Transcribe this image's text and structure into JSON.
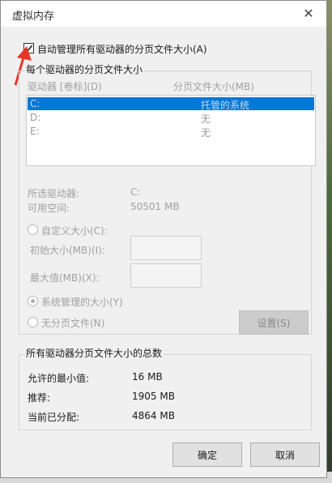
{
  "dialog": {
    "title": "虚拟内存"
  },
  "auto_manage": {
    "label": "自动管理所有驱动器的分页文件大小(A)",
    "checked": true
  },
  "drives_group": {
    "title": "每个驱动器的分页文件大小",
    "col_drive": "驱动器 [卷标](D)",
    "col_size": "分页文件大小(MB)",
    "rows": [
      {
        "drive": "C:",
        "size": "托管的系统",
        "selected": true
      },
      {
        "drive": "D:",
        "size": "无",
        "selected": false
      },
      {
        "drive": "E:",
        "size": "无",
        "selected": false
      }
    ]
  },
  "selected_info": {
    "drive_label": "所选驱动器:",
    "drive_value": "C:",
    "space_label": "可用空间:",
    "space_value": "50501 MB"
  },
  "custom_size": {
    "label": "自定义大小(C):",
    "initial_label": "初始大小(MB)(I):",
    "initial_value": "",
    "max_label": "最大值(MB)(X):",
    "max_value": ""
  },
  "system_managed": {
    "label": "系统管理的大小(Y)",
    "selected": true
  },
  "no_paging": {
    "label": "无分页文件(N)",
    "selected": false
  },
  "set_button": "设置(S)",
  "totals_group": {
    "title": "所有驱动器分页文件大小的总数",
    "min_label": "允许的最小值:",
    "min_value": "16 MB",
    "recommended_label": "推荐:",
    "recommended_value": "1905 MB",
    "allocated_label": "当前已分配:",
    "allocated_value": "4864 MB"
  },
  "buttons": {
    "ok": "确定",
    "cancel": "取消"
  },
  "colors": {
    "accent": "#0078d7",
    "annotation": "#e8352a"
  },
  "icons": {
    "close": "close-icon",
    "check": "checkmark-icon",
    "annotation": "red-arrow-icon"
  }
}
